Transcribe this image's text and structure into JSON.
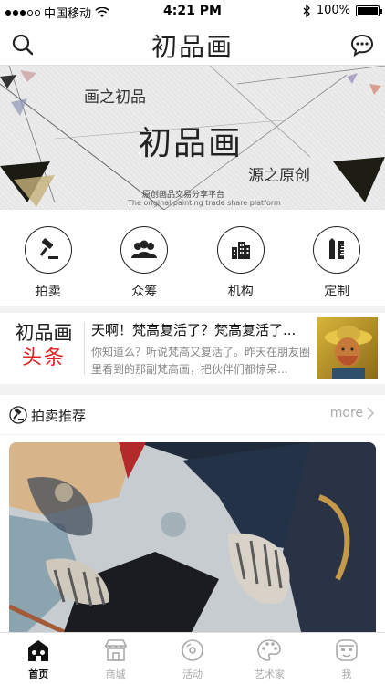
{
  "status_bar": {
    "carrier": "中国移动",
    "time": "4:21 PM",
    "battery": "100%",
    "battery_level": 1.0
  },
  "nav": {
    "title": "初品画",
    "search_icon": "search-icon",
    "chat_icon": "chat-icon"
  },
  "banner": {
    "line1": "画之初品",
    "line2": "初品画",
    "line3": "源之原创",
    "subtitle_cn": "原创画品交易分享平台",
    "subtitle_en": "The original painting trade share platform"
  },
  "menu": {
    "items": [
      {
        "label": "拍卖",
        "icon": "gavel-icon"
      },
      {
        "label": "众筹",
        "icon": "group-icon"
      },
      {
        "label": "机构",
        "icon": "building-icon"
      },
      {
        "label": "定制",
        "icon": "pen-ruler-icon"
      }
    ]
  },
  "news": {
    "logo_top": "初品画",
    "logo_bottom": "头条",
    "title": "天啊！梵高复活了？梵高复活了...",
    "summary": "你知道么？听说梵高又复活了。昨天在朋友圈里看到的那副梵高画，把伙伴们都惊呆..."
  },
  "section": {
    "title": "拍卖推荐",
    "more": "more"
  },
  "tabbar": {
    "tabs": [
      {
        "label": "首页",
        "icon": "home-icon",
        "active": true
      },
      {
        "label": "商城",
        "icon": "shop-icon",
        "active": false
      },
      {
        "label": "活动",
        "icon": "activity-icon",
        "active": false
      },
      {
        "label": "艺术家",
        "icon": "palette-icon",
        "active": false
      },
      {
        "label": "我",
        "icon": "profile-icon",
        "active": false
      }
    ]
  },
  "colors": {
    "accent_red": "#e02020",
    "text_dark": "#222222",
    "text_gray": "#888888"
  }
}
